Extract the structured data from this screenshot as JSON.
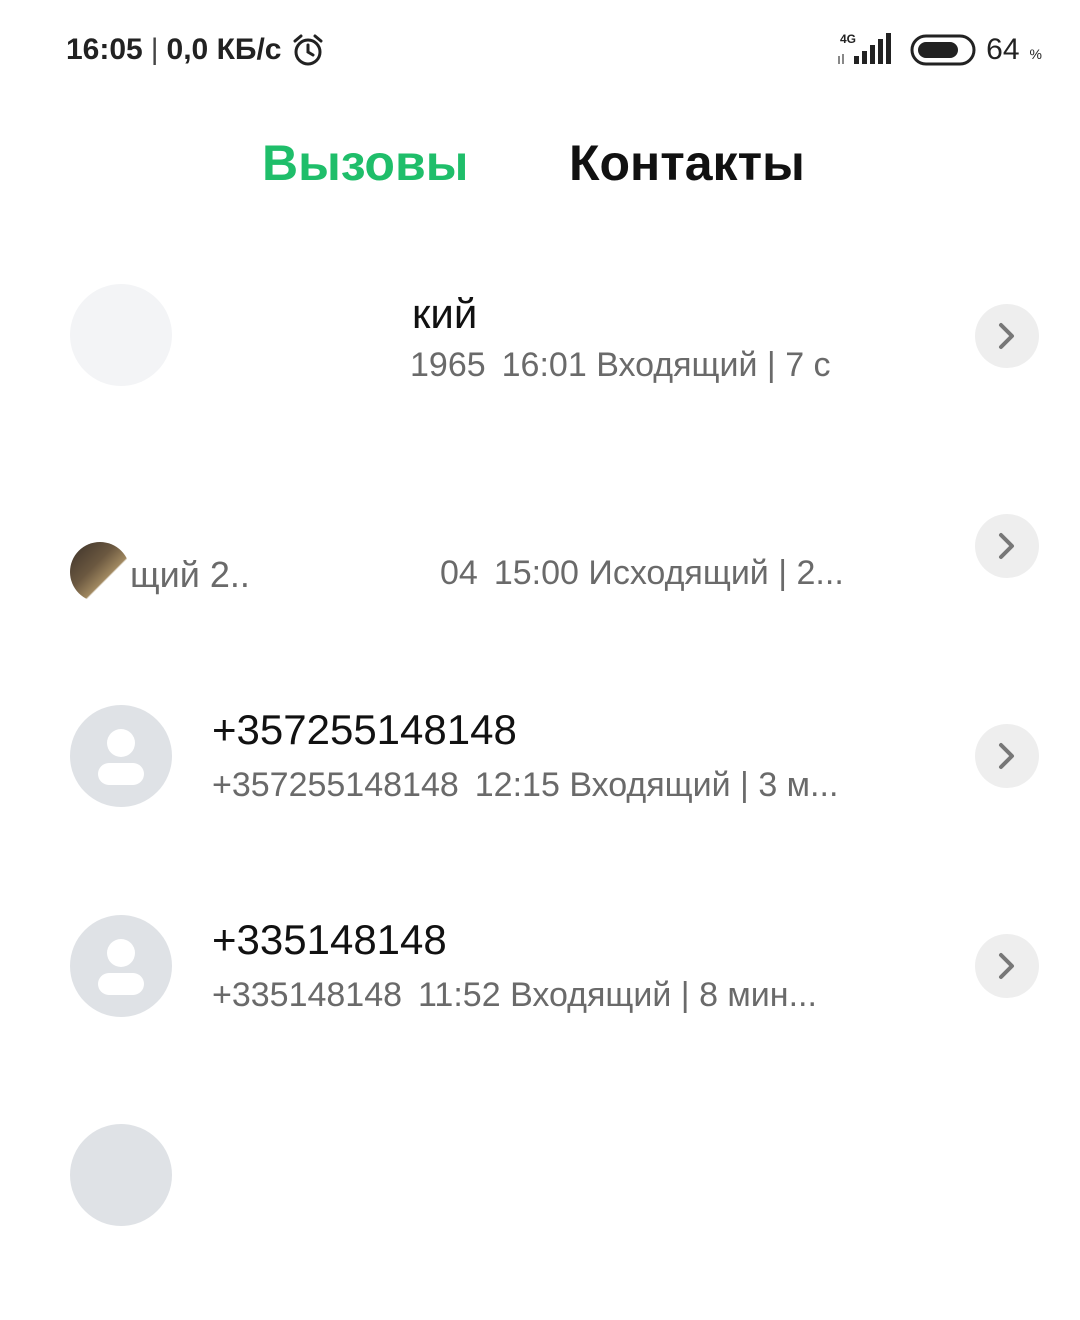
{
  "status_bar": {
    "time": "16:05",
    "network_speed": "0,0 КБ/с",
    "network_type": "4G",
    "battery_level": "64",
    "battery_unit": "%",
    "icons": [
      "alarm-icon",
      "signal-icon",
      "battery-icon"
    ]
  },
  "tabs": [
    {
      "label": "Вызовы",
      "active": true,
      "color": "#1fbe6a"
    },
    {
      "label": "Контакты",
      "active": false,
      "color": "#111111"
    }
  ],
  "calls": [
    {
      "name": "кий",
      "number": "1965",
      "time": "16:01",
      "type_duration": "Входящий | 7 с",
      "avatar": "photo"
    },
    {
      "name": "щий 2..",
      "number": "04",
      "time": "15:00",
      "type_duration": "Исходящий | 2...",
      "avatar": "photo"
    },
    {
      "name": "+357255148148",
      "number": "+357255148148",
      "time": "12:15",
      "type_duration": "Входящий | 3 м...",
      "avatar": "placeholder"
    },
    {
      "name": "+335148148",
      "number": "+335148148",
      "time": "11:52",
      "type_duration": "Входящий | 8 мин...",
      "avatar": "placeholder"
    }
  ]
}
